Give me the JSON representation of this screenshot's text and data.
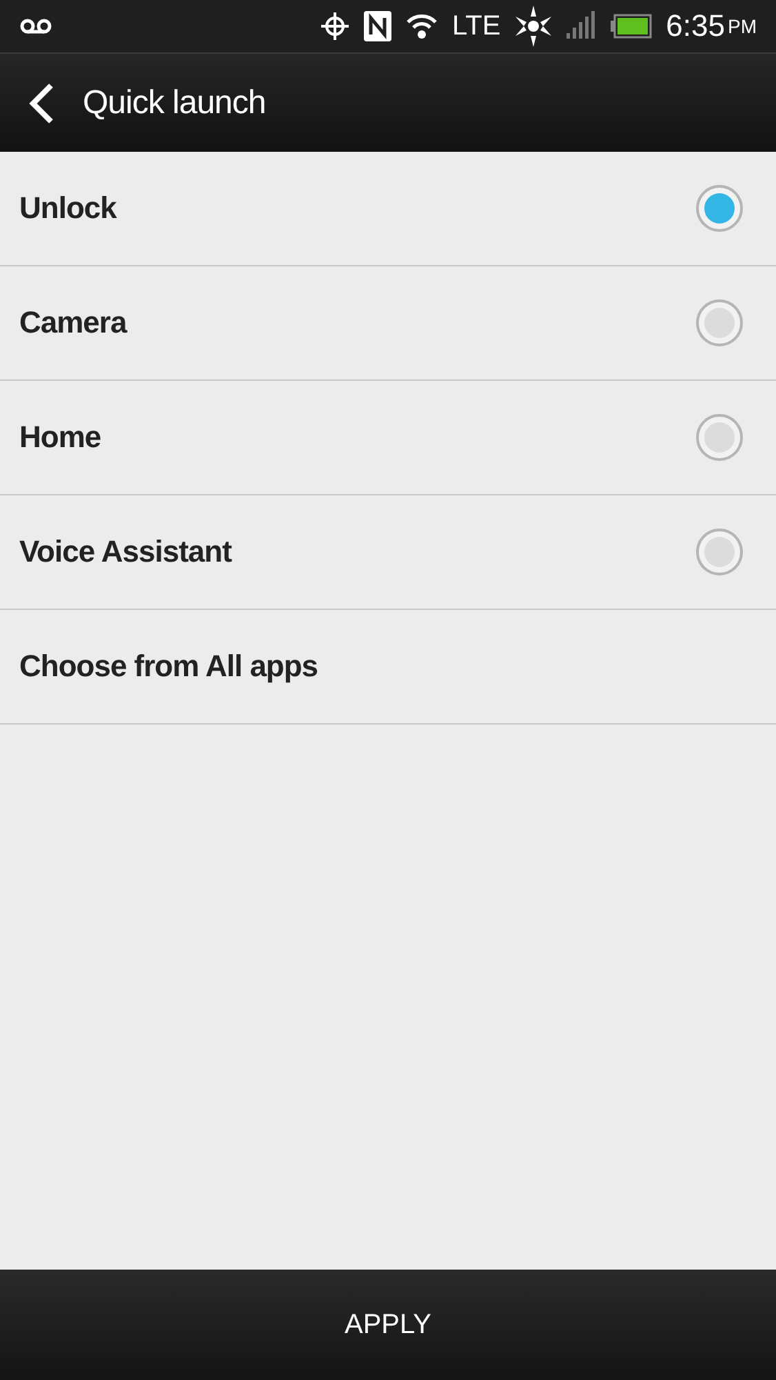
{
  "status_bar": {
    "network": "LTE",
    "time": "6:35",
    "meridiem": "PM"
  },
  "header": {
    "title": "Quick launch"
  },
  "options": [
    {
      "label": "Unlock",
      "kind": "radio",
      "selected": true
    },
    {
      "label": "Camera",
      "kind": "radio",
      "selected": false
    },
    {
      "label": "Home",
      "kind": "radio",
      "selected": false
    },
    {
      "label": "Voice Assistant",
      "kind": "radio",
      "selected": false
    },
    {
      "label": "Choose from All apps",
      "kind": "link"
    }
  ],
  "footer": {
    "button": "APPLY"
  }
}
